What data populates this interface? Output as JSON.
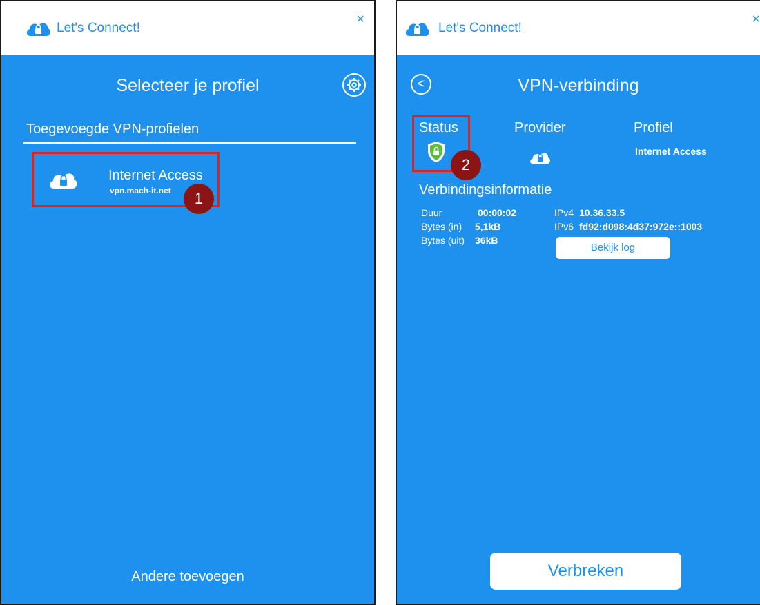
{
  "colors": {
    "accent": "#1e90ee",
    "highlight": "#e0221c",
    "badge": "#8b1414"
  },
  "left_window": {
    "title": "Let's Connect!",
    "close_glyph": "×",
    "heading": "Selecteer je profiel",
    "settings_icon": "gear-icon",
    "section_title": "Toegevoegde VPN-profielen",
    "profile": {
      "name": "Internet Access",
      "host": "vpn.mach-it.net",
      "icon": "cloud-lock-icon"
    },
    "badge": "1",
    "add_other_label": "Andere toevoegen"
  },
  "right_window": {
    "title": "Let's Connect!",
    "close_glyph": "×",
    "back_glyph": "<",
    "heading": "VPN-verbinding",
    "status_label": "Status",
    "provider_label": "Provider",
    "profile_label": "Profiel",
    "profile_value": "Internet Access",
    "badge": "2",
    "conn_info_title": "Verbindingsinformatie",
    "info": {
      "duur_label": "Duur",
      "duur_value": "00:00:02",
      "bytes_in_label": "Bytes (in)",
      "bytes_in_value": "5,1kB",
      "bytes_out_label": "Bytes (uit)",
      "bytes_out_value": "36kB",
      "ipv4_label": "IPv4",
      "ipv4_value": "10.36.33.5",
      "ipv6_label": "IPv6",
      "ipv6_value": "fd92:d098:4d37:972e::1003"
    },
    "log_button": "Bekijk log",
    "disconnect_button": "Verbreken"
  }
}
